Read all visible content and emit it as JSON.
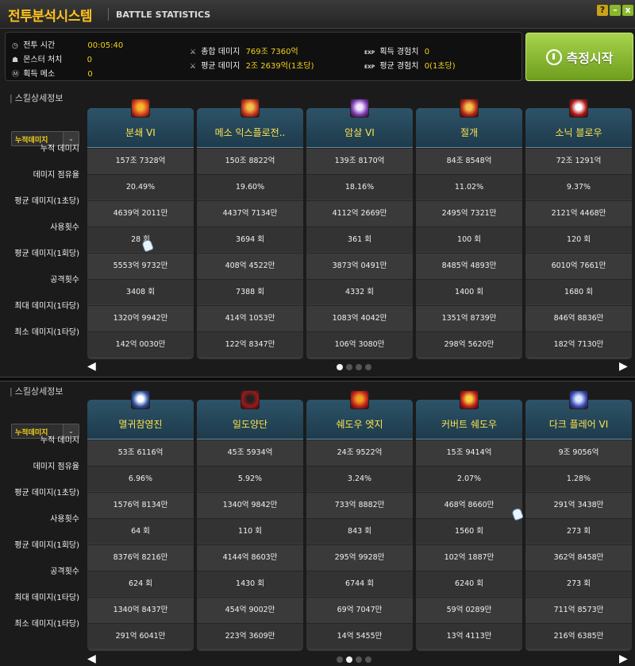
{
  "window": {
    "title_ko": "전투분석시스템",
    "title_en": "BATTLE STATISTICS",
    "help": "?",
    "minimize": "–",
    "close": "x"
  },
  "summary": {
    "battle_time_label": "전투 시간",
    "battle_time": "00:05:40",
    "monster_kills_label": "몬스터 처치",
    "monster_kills": "0",
    "meso_label": "획득 메소",
    "meso": "0",
    "total_damage_label": "총합 데미지",
    "total_damage": "769조 7360억",
    "avg_damage_label": "평균 데미지",
    "avg_damage": "2조 2639억(1초당)",
    "exp_tag": "EXP",
    "exp_gain_label": "획득 경험치",
    "exp_gain": "0",
    "avg_exp_label": "평균 경험치",
    "avg_exp": "0(1초당)"
  },
  "measure_button": "측정시작",
  "row_labels": [
    "누적 데미지",
    "데미지 점유율",
    "평균 데미지(1초당)",
    "사용횟수",
    "평균 데미지(1회당)",
    "공격횟수",
    "최대 데미지(1타당)",
    "최소 데미지(1타당)"
  ],
  "sections": [
    {
      "title": "스킬상세정보",
      "dropdown": "누적데미지",
      "dropdown_arrow": "⌄",
      "prev": "◀",
      "next": "▶",
      "skills": [
        {
          "name": "분쇄 VI",
          "icon": "skill-icon-red-blast",
          "values": [
            "157조 7328억",
            "20.49%",
            "4639억 2011만",
            "28 회",
            "5553억 9732만",
            "3408 회",
            "1320억 9942만",
            "142억 0030만"
          ]
        },
        {
          "name": "메소 익스플로전..",
          "icon": "skill-icon-meso-explosion",
          "values": [
            "150조 8822억",
            "19.60%",
            "4437억 7134만",
            "3694 회",
            "408억 4522만",
            "7388 회",
            "414억 1053만",
            "122억 8347만"
          ]
        },
        {
          "name": "암살 VI",
          "icon": "skill-icon-assassinate",
          "values": [
            "139조 8170억",
            "18.16%",
            "4112억 2669만",
            "361 회",
            "3873억 0491만",
            "4332 회",
            "1083억 4042만",
            "106억 3080만"
          ]
        },
        {
          "name": "절개",
          "icon": "skill-icon-slash",
          "values": [
            "84조 8548억",
            "11.02%",
            "2495억 7321만",
            "100 회",
            "8485억 4893만",
            "1400 회",
            "1351억 8739만",
            "298억 5620만"
          ]
        },
        {
          "name": "소닉 블로우",
          "icon": "skill-icon-sonic-blow",
          "values": [
            "72조 1291억",
            "9.37%",
            "2121억 4468만",
            "120 회",
            "6010억 7661만",
            "1680 회",
            "846억 8836만",
            "182억 7130만"
          ]
        }
      ]
    },
    {
      "title": "스킬상세정보",
      "dropdown": "누적데미지",
      "dropdown_arrow": "⌄",
      "prev": "◀",
      "next": "▶",
      "skills": [
        {
          "name": "멸귀참영진",
          "icon": "skill-icon-blue-spirit",
          "values": [
            "53조 6116억",
            "6.96%",
            "1576억 8134만",
            "64 회",
            "8376억 8216만",
            "624 회",
            "1340억 8437만",
            "291억 6041만"
          ]
        },
        {
          "name": "일도양단",
          "icon": "skill-icon-red-cleave",
          "values": [
            "45조 5934억",
            "5.92%",
            "1340억 9842만",
            "110 회",
            "4144억 8603만",
            "1430 회",
            "454억 9002만",
            "223억 3609만"
          ]
        },
        {
          "name": "쉐도우 엣지",
          "icon": "skill-icon-shadow-edge",
          "values": [
            "24조 9522억",
            "3.24%",
            "733억 8882만",
            "843 회",
            "295억 9928만",
            "6744 회",
            "69억 7047만",
            "14억 5455만"
          ]
        },
        {
          "name": "커버트 쉐도우",
          "icon": "skill-icon-covert-shadow",
          "values": [
            "15조 9414억",
            "2.07%",
            "468억 8660만",
            "1560 회",
            "102억 1887만",
            "6240 회",
            "59억 0289만",
            "13억 4113만"
          ]
        },
        {
          "name": "다크 플레어 VI",
          "icon": "skill-icon-dark-flare",
          "values": [
            "9조 9056억",
            "1.28%",
            "291억 3438만",
            "273 회",
            "362억 8458만",
            "273 회",
            "711억 8573만",
            "216억 6385만"
          ]
        }
      ]
    }
  ],
  "colors": {
    "accent": "#ffc21a",
    "value": "#f3d11a",
    "header": "#2d5368",
    "button": "#8ab62a"
  }
}
